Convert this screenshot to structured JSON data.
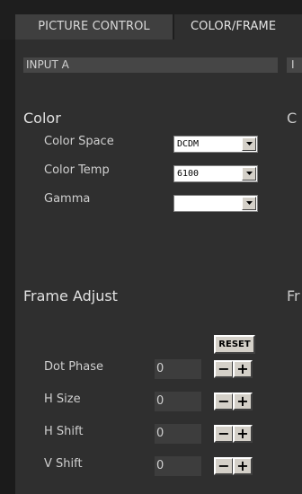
{
  "tabs": [
    {
      "label": "PICTURE CONTROL",
      "active": false
    },
    {
      "label": "COLOR/FRAME",
      "active": true
    }
  ],
  "inputA": {
    "header": "INPUT A",
    "color": {
      "title": "Color",
      "rows": [
        {
          "label": "Color Space",
          "value": "DCDM"
        },
        {
          "label": "Color Temp",
          "value": "6100"
        },
        {
          "label": "Gamma",
          "value": ""
        }
      ]
    },
    "frame": {
      "title": "Frame Adjust",
      "reset_label": "RESET",
      "rows": [
        {
          "label": "Dot Phase",
          "value": "0"
        },
        {
          "label": "H Size",
          "value": "0"
        },
        {
          "label": "H Shift",
          "value": "0"
        },
        {
          "label": "V Shift",
          "value": "0"
        }
      ],
      "minus_symbol": "−",
      "plus_symbol": "+"
    }
  },
  "inputB_partial": {
    "header": "I",
    "color_title": "C",
    "frame_title": "Fr"
  },
  "colors": {
    "background": "#1b1b1b",
    "panel": "#2f2f2f",
    "section_header": "#464646",
    "inactive_tab": "#3f3f3f",
    "button_face": "#d4d0c8"
  },
  "icons": {
    "dropdown_arrow": "chevron-down-icon"
  }
}
